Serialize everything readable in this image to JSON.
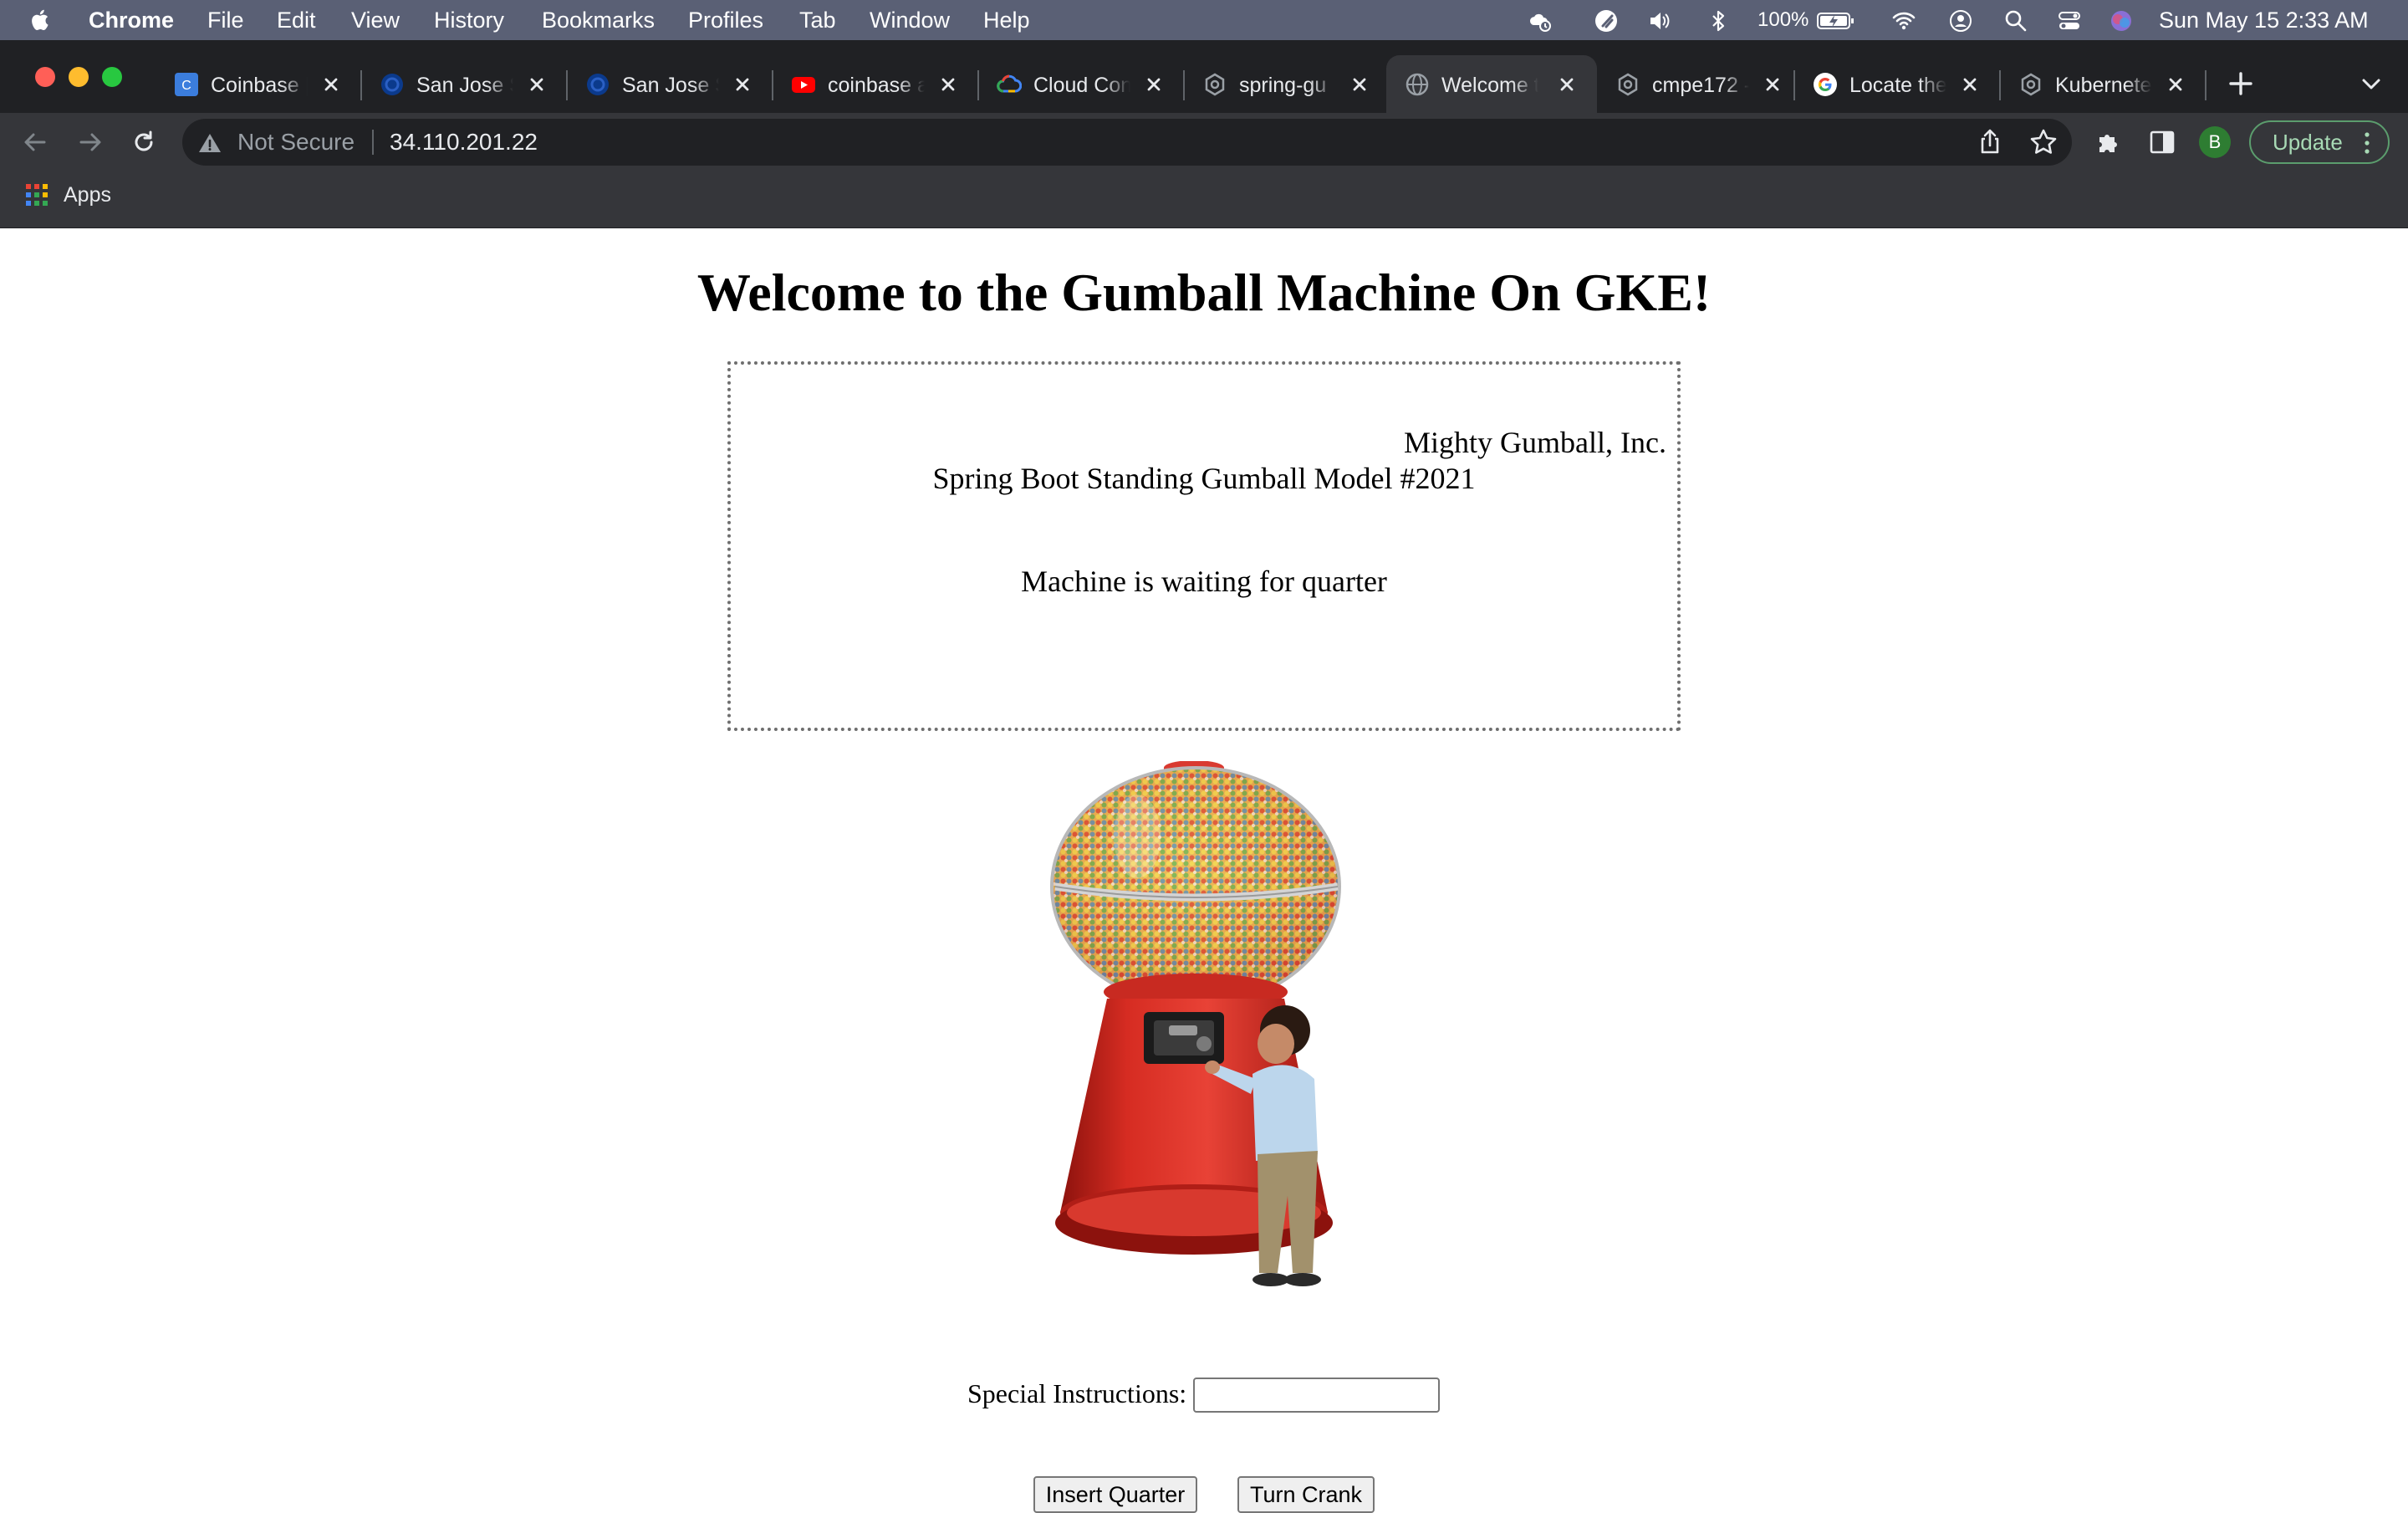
{
  "menubar": {
    "items": [
      "Chrome",
      "File",
      "Edit",
      "View",
      "History",
      "Bookmarks",
      "Profiles",
      "Tab",
      "Window",
      "Help"
    ],
    "battery": "100%",
    "clock": "Sun May 15  2:33 AM"
  },
  "tabs": [
    {
      "title": "Coinbase | ",
      "favicon": "coinbase-favicon",
      "active": false
    },
    {
      "title": "San Jose S",
      "favicon": "sjsu-favicon",
      "active": false
    },
    {
      "title": "San Jose S",
      "favicon": "sjsu-favicon",
      "active": false
    },
    {
      "title": "coinbase a",
      "favicon": "youtube-favicon",
      "active": false
    },
    {
      "title": "Cloud Con",
      "favicon": "google-cloud-favicon",
      "active": false
    },
    {
      "title": "spring-gu",
      "favicon": "generic-page-favicon",
      "active": false
    },
    {
      "title": "Welcome t",
      "favicon": "globe-favicon",
      "active": true
    },
    {
      "title": "cmpe172 - ",
      "favicon": "generic-page-favicon",
      "active": false
    },
    {
      "title": "Locate the",
      "favicon": "google-favicon",
      "active": false
    },
    {
      "title": "Kubernete",
      "favicon": "generic-page-favicon",
      "active": false
    }
  ],
  "toolbar": {
    "security_label": "Not Secure",
    "url": "34.110.201.22",
    "profile_initial": "B",
    "update_label": "Update"
  },
  "bookmarks": {
    "apps_label": "Apps"
  },
  "page": {
    "title": "Welcome to the Gumball Machine On GKE!",
    "company": "Mighty Gumball, Inc.",
    "model": "Spring Boot Standing Gumball Model #2021",
    "state": "Machine is waiting for quarter",
    "image_alt": "gumball machine with child",
    "instructions_label": "Special Instructions:",
    "instructions_value": "",
    "insert_quarter_label": "Insert Quarter",
    "turn_crank_label": "Turn Crank"
  },
  "colors": {
    "menubar": "#5a6075",
    "tabstrip": "#202124",
    "toolbar": "#35363a",
    "gumball_red": "#c9271f"
  }
}
